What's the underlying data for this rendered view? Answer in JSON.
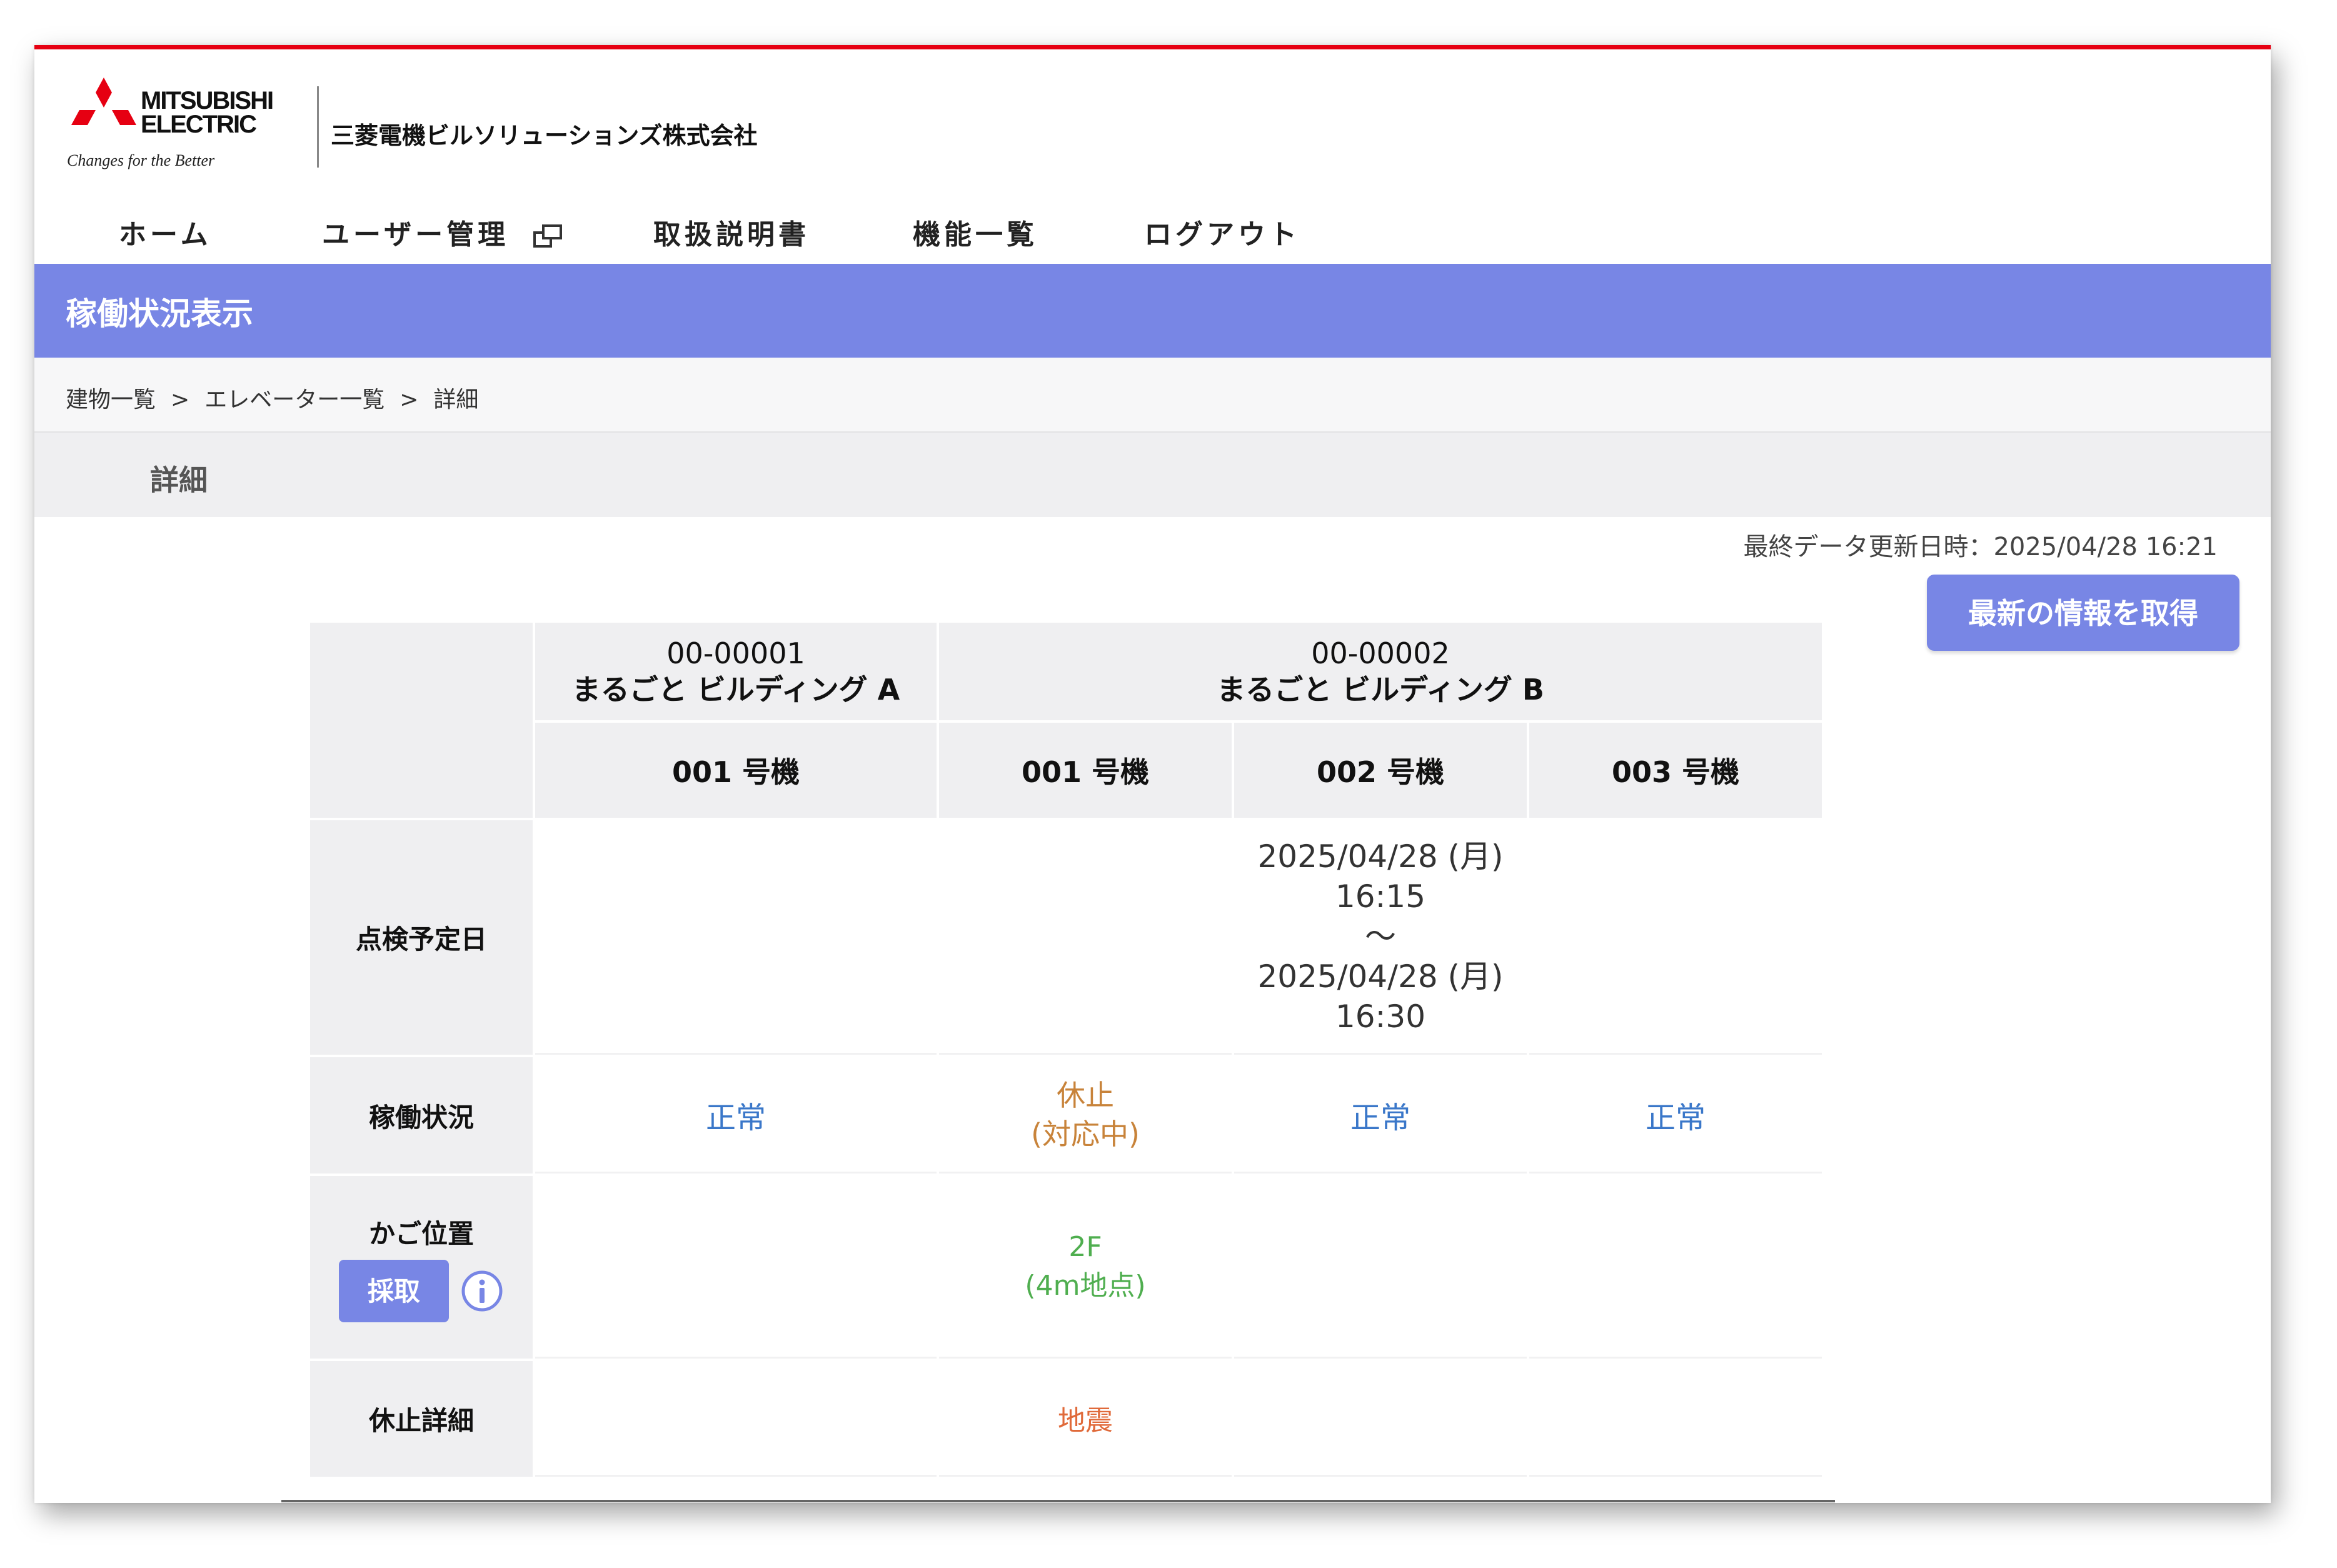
{
  "header": {
    "brand_line1": "MITSUBISHI",
    "brand_line2": "ELECTRIC",
    "tagline": "Changes for the Better",
    "company": "三菱電機ビルソリューションズ株式会社",
    "accent_color": "#e60012"
  },
  "nav": {
    "items": [
      {
        "label": "ホーム"
      },
      {
        "label": "ユーザー管理",
        "icon": "external-window-icon"
      },
      {
        "label": "取扱説明書"
      },
      {
        "label": "機能一覧"
      },
      {
        "label": "ログアウト"
      }
    ]
  },
  "title_bar": {
    "title": "稼働状況表示",
    "color": "#7886e5"
  },
  "breadcrumb": {
    "items": [
      "建物一覧",
      "エレベーター一覧",
      "詳細"
    ],
    "separator": ">"
  },
  "section": {
    "title": "詳細"
  },
  "status": {
    "last_updated": "最終データ更新日時：2025/04/28 16:21",
    "refresh_label": "最新の情報を取得"
  },
  "table": {
    "buildings": [
      {
        "code": "00-00001",
        "name": "まるごと ビルディング  A"
      },
      {
        "code": "00-00002",
        "name": "まるごと ビルディング  B"
      }
    ],
    "units": [
      "001 号機",
      "001 号機",
      "002 号機",
      "003 号機"
    ],
    "row_labels": {
      "inspection": "点検予定日",
      "operation": "稼働状況",
      "car_position": "かご位置",
      "stop_detail": "休止詳細"
    },
    "fetch_label": "採取",
    "inspection": [
      {
        "lines": []
      },
      {
        "lines": []
      },
      {
        "lines": [
          "2025/04/28 (月)",
          "16:15",
          "～",
          "2025/04/28 (月)",
          "16:30"
        ]
      },
      {
        "lines": []
      }
    ],
    "operation": [
      {
        "lines": [
          "正常"
        ],
        "state": "normal"
      },
      {
        "lines": [
          "休止",
          "(対応中)"
        ],
        "state": "stopped"
      },
      {
        "lines": [
          "正常"
        ],
        "state": "normal"
      },
      {
        "lines": [
          "正常"
        ],
        "state": "normal"
      }
    ],
    "car_position": [
      {
        "lines": []
      },
      {
        "lines": [
          "2F",
          "(4m地点)"
        ]
      },
      {
        "lines": []
      },
      {
        "lines": []
      }
    ],
    "stop_detail": [
      {
        "text": ""
      },
      {
        "text": "地震"
      },
      {
        "text": ""
      },
      {
        "text": ""
      }
    ],
    "colors": {
      "normal": "#3a77c9",
      "stopped": "#c8833a",
      "position": "#4fae4f",
      "quake": "#e06a3a"
    }
  }
}
